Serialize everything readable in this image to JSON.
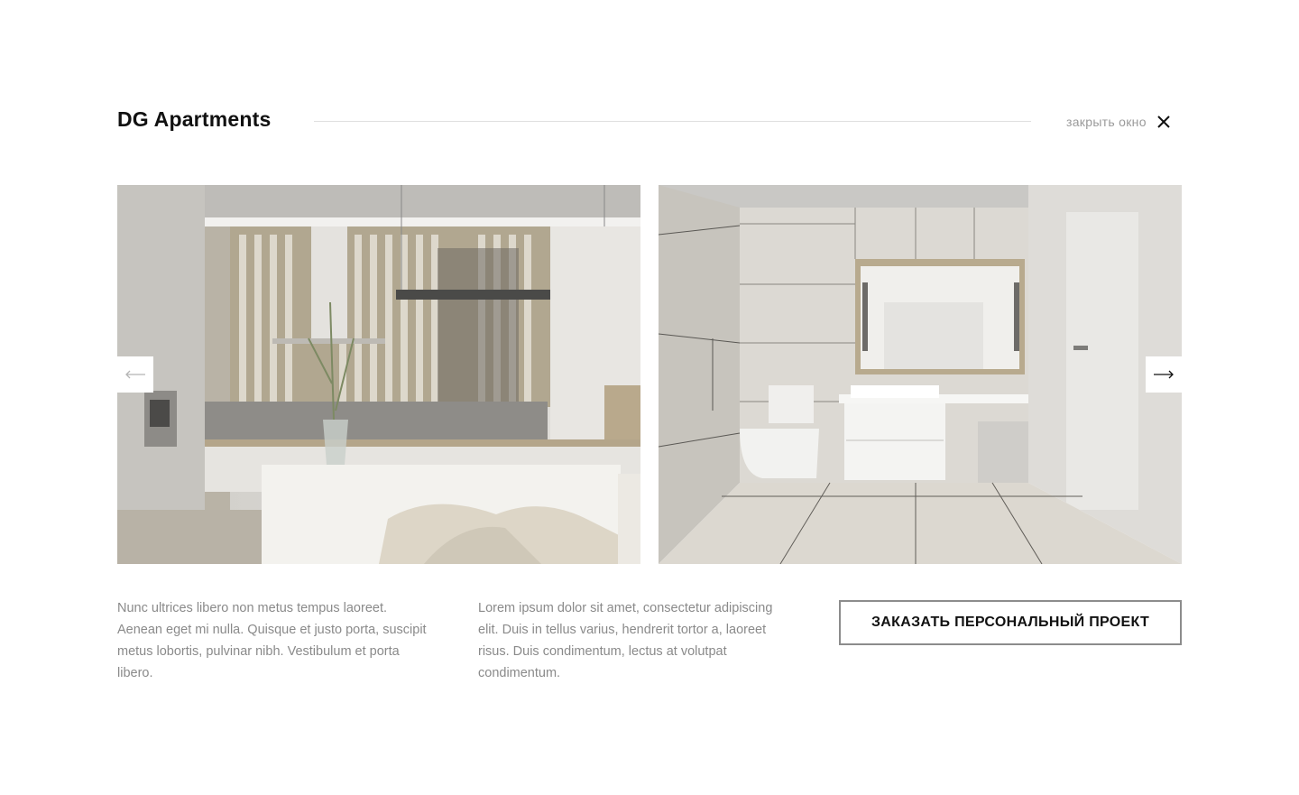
{
  "header": {
    "title": "DG Apartments",
    "close_label": "закрыть окно"
  },
  "gallery": {
    "images": [
      {
        "alt": "kitchen interior with wooden slat partition"
      },
      {
        "alt": "bathroom interior with vanity, mirror and toilet"
      }
    ],
    "prev_icon": "arrow-left-icon",
    "next_icon": "arrow-right-icon"
  },
  "content": {
    "paragraph_1": "Nunc ultrices libero non metus tempus laoreet. Aenean eget mi nulla. Quisque et justo porta, suscipit metus lobortis, pulvinar nibh. Vestibulum et porta libero.",
    "paragraph_2": "Lorem ipsum dolor sit amet, consectetur adipiscing elit. Duis in tellus varius, hendrerit tortor a, laoreet risus. Duis condimentum, lectus at volutpat condimentum.",
    "order_button": "ЗАКАЗАТЬ ПЕРСОНАЛЬНЫЙ ПРОЕКТ"
  },
  "colors": {
    "title_text": "#111111",
    "muted_text": "#8a8a8a",
    "button_border": "#8c8c8c"
  }
}
